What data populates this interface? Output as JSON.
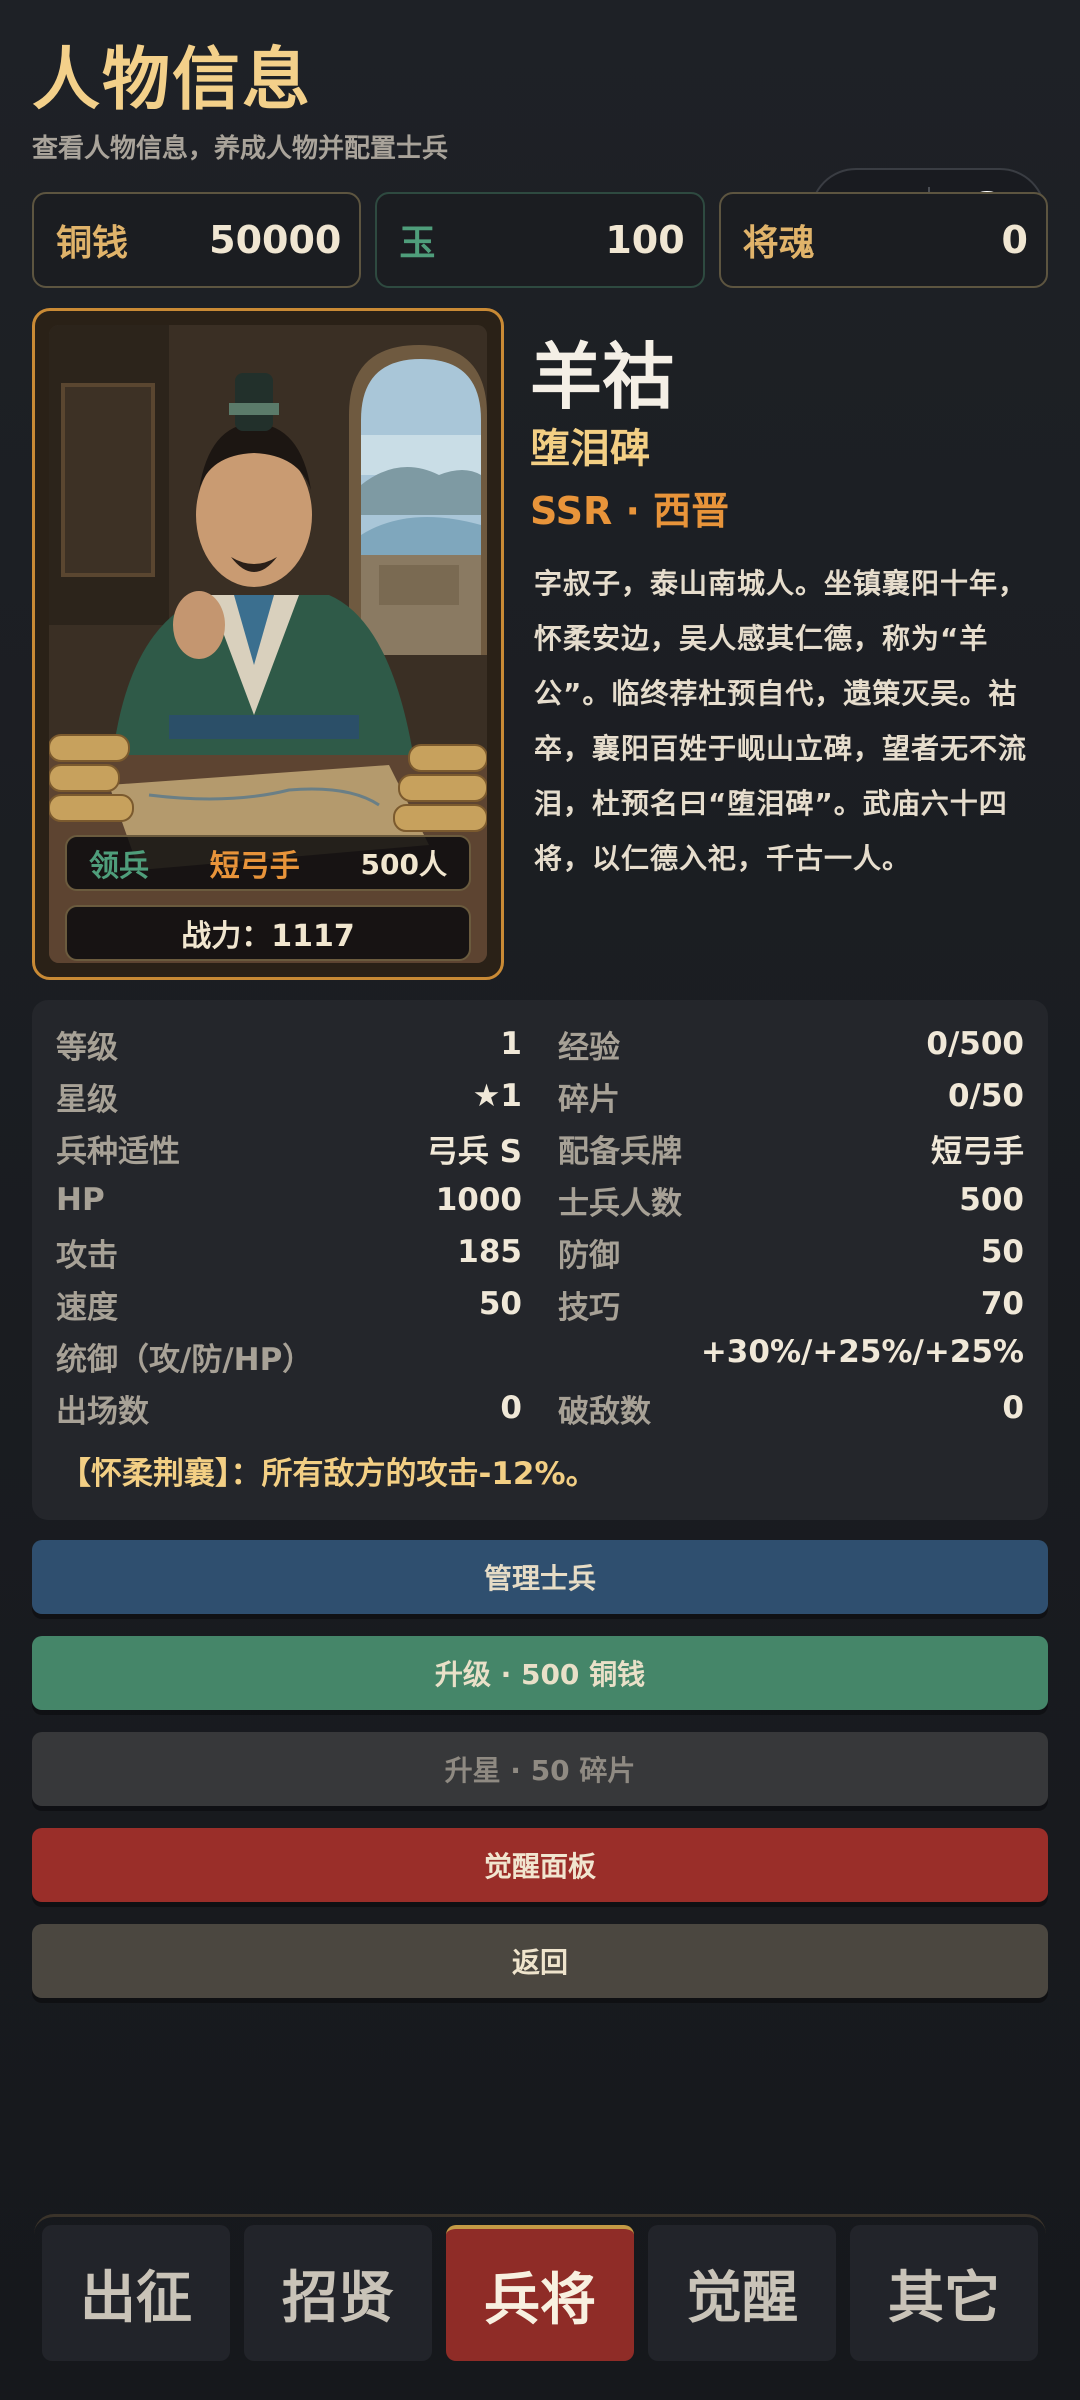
{
  "header": {
    "title": "人物信息",
    "subtitle": "查看人物信息，养成人物并配置士兵"
  },
  "currency": [
    {
      "label": "铜钱",
      "value": "50000"
    },
    {
      "label": "玉",
      "value": "100"
    },
    {
      "label": "将魂",
      "value": "0"
    }
  ],
  "hero": {
    "name": "羊祜",
    "title": "堕泪碑",
    "rarity_line": "SSR · 西晋",
    "bio": "字叔子，泰山南城人。坐镇襄阳十年，怀柔安边，吴人感其仁德，称为“羊公”。临终荐杜预自代，遗策灭吴。祜卒，襄阳百姓于岘山立碑，望者无不流泪，杜预名曰“堕泪碑”。武庙六十四将，以仁德入祀，千古一人。",
    "troop_label": "领兵",
    "troop_type": "短弓手",
    "troop_count": "500人",
    "power": "战力：1117"
  },
  "stats": {
    "rows": [
      {
        "k1": "等级",
        "v1": "1",
        "k2": "经验",
        "v2": "0/500"
      },
      {
        "k1": "星级",
        "v1": "★1",
        "k2": "碎片",
        "v2": "0/50"
      },
      {
        "k1": "兵种适性",
        "v1": "弓兵 S",
        "k2": "配备兵牌",
        "v2": "短弓手"
      },
      {
        "k1": "HP",
        "v1": "1000",
        "k2": "士兵人数",
        "v2": "500"
      },
      {
        "k1": "攻击",
        "v1": "185",
        "k2": "防御",
        "v2": "50"
      },
      {
        "k1": "速度",
        "v1": "50",
        "k2": "技巧",
        "v2": "70"
      }
    ],
    "command_key": "统御（攻/防/HP）",
    "command_val": "+30%/+25%/+25%",
    "last_row": {
      "k1": "出场数",
      "v1": "0",
      "k2": "破敌数",
      "v2": "0"
    },
    "skill": "【怀柔荆襄】：所有敌方的攻击-12%。"
  },
  "actions": {
    "manage": "管理士兵",
    "upgrade": "升级 · 500 铜钱",
    "star": "升星 · 50 碎片",
    "awaken": "觉醒面板",
    "back": "返回"
  },
  "nav": [
    "出征",
    "招贤",
    "兵将",
    "觉醒",
    "其它"
  ],
  "colors": {
    "gold": "#f3d08a",
    "orange": "#e8943a",
    "jade": "#4f9e7b",
    "active_tab": "#8f2c27"
  }
}
